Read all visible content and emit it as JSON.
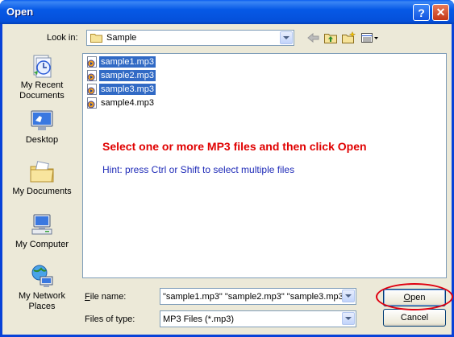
{
  "window": {
    "title": "Open",
    "help_button": "?",
    "close_button": "✕",
    "colors": {
      "titlebar": "#0659e6",
      "client": "#ece9d8",
      "selection": "#316ac5",
      "message": "#e00000",
      "hint": "#1f2bb8",
      "annotation_ring": "#e00010"
    }
  },
  "toolbar": {
    "lookin_label": "Look in:",
    "lookin_value": "Sample",
    "icons": [
      "back-arrow-icon",
      "up-folder-icon",
      "new-folder-icon",
      "view-menu-icon"
    ]
  },
  "places": [
    {
      "label": "My Recent Documents",
      "icon": "recent-documents-icon"
    },
    {
      "label": "Desktop",
      "icon": "desktop-icon"
    },
    {
      "label": "My Documents",
      "icon": "my-documents-icon"
    },
    {
      "label": "My Computer",
      "icon": "my-computer-icon"
    },
    {
      "label": "My Network Places",
      "icon": "network-places-icon"
    }
  ],
  "files": [
    {
      "name": "sample1.mp3",
      "selected": true
    },
    {
      "name": "sample2.mp3",
      "selected": true
    },
    {
      "name": "sample3.mp3",
      "selected": true
    },
    {
      "name": "sample4.mp3",
      "selected": false
    }
  ],
  "overlay": {
    "message": "Select one or more MP3 files and then click Open",
    "hint": "Hint: press Ctrl or Shift to select multiple files"
  },
  "footer": {
    "filename_label": "File name:",
    "filename_value": "\"sample1.mp3\" \"sample2.mp3\" \"sample3.mp3\"",
    "filetype_label": "Files of type:",
    "filetype_value": "MP3 Files (*.mp3)",
    "open_button": "Open",
    "cancel_button": "Cancel"
  }
}
